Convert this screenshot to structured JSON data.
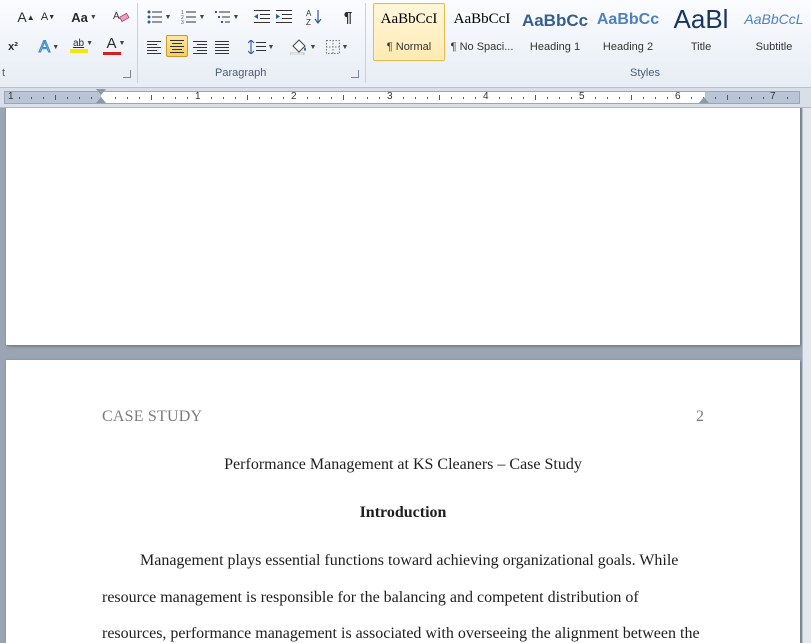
{
  "font_group": {
    "label": "t",
    "grow_font": "A",
    "shrink_font": "A",
    "change_case": "Aa",
    "superscript": "x²",
    "text_effects": "A",
    "highlight": "ab",
    "font_color": "A",
    "font_color_value": "#d42020",
    "highlight_color_value": "#f5e800"
  },
  "paragraph_group": {
    "label": "Paragraph",
    "sort": "A↓Z",
    "show_marks": "¶"
  },
  "styles_group": {
    "label": "Styles",
    "items": [
      {
        "sample": "AaBbCcI",
        "name": "¶ Normal"
      },
      {
        "sample": "AaBbCcI",
        "name": "¶ No Spaci..."
      },
      {
        "sample": "AaBbCc",
        "name": "Heading 1"
      },
      {
        "sample": "AaBbCc",
        "name": "Heading 2"
      },
      {
        "sample": "AaBl",
        "name": "Title"
      },
      {
        "sample": "AaBbCcL",
        "name": "Subtitle"
      }
    ]
  },
  "ruler": {
    "numbers": [
      "1",
      "1",
      "2",
      "3",
      "4",
      "5",
      "6",
      "7"
    ]
  },
  "document": {
    "running_head": "CASE STUDY",
    "page_number": "2",
    "title": "Performance Management at KS Cleaners – Case Study",
    "heading": "Introduction",
    "lines": [
      "Management plays essential functions toward achieving organizational goals. While",
      "resource management is responsible for the balancing and competent distribution of",
      "resources, performance management is associated with overseeing the alignment between the"
    ]
  }
}
